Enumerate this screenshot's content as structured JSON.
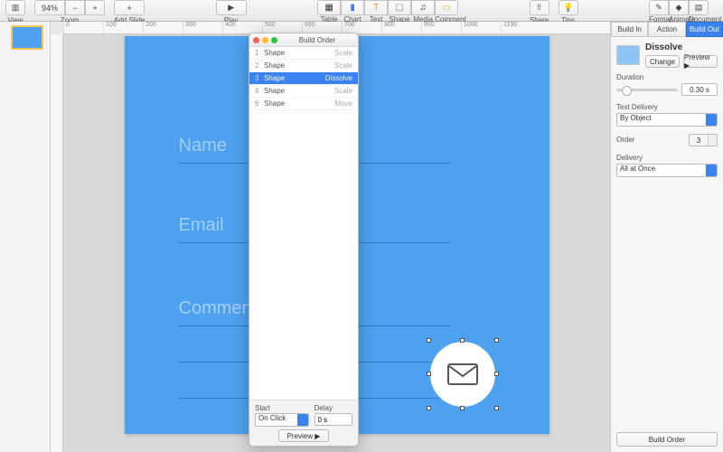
{
  "toolbar": {
    "view_label": "View",
    "zoom_value": "94%",
    "zoom_label": "Zoom",
    "add_slide_label": "Add Slide",
    "play_label": "Play",
    "mid": [
      "Table",
      "Chart",
      "Text",
      "Shape",
      "Media",
      "Comment"
    ],
    "share_label": "Share",
    "tips_label": "Tips",
    "right": [
      "Format",
      "Animate",
      "Document"
    ]
  },
  "slide": {
    "fields": [
      "Name",
      "Email",
      "Comments"
    ]
  },
  "ruler": [
    "0",
    "100",
    "200",
    "300",
    "400",
    "500",
    "600",
    "700",
    "800",
    "900",
    "1000",
    "1100"
  ],
  "build_order": {
    "title": "Build Order",
    "rows": [
      {
        "n": "1",
        "name": "Shape",
        "effect": "Scale"
      },
      {
        "n": "2",
        "name": "Shape",
        "effect": "Scale"
      },
      {
        "n": "3",
        "name": "Shape",
        "effect": "Dissolve",
        "selected": true
      },
      {
        "n": "4",
        "name": "Shape",
        "effect": "Scale"
      },
      {
        "n": "6",
        "name": "Shape",
        "effect": "Move"
      }
    ],
    "start_label": "Start",
    "start_value": "On Click",
    "delay_label": "Delay",
    "delay_value": "0 s",
    "preview_label": "Preview ▶"
  },
  "inspector": {
    "tabs": [
      "Build In",
      "Action",
      "Build Out"
    ],
    "effect_name": "Dissolve",
    "change_label": "Change",
    "preview_label": "Preview ▶",
    "duration_label": "Duration",
    "duration_value": "0.30 s",
    "text_delivery_label": "Text Delivery",
    "text_delivery_value": "By Object",
    "order_label": "Order",
    "order_value": "3",
    "delivery_label": "Delivery",
    "delivery_value": "All at Once",
    "build_order_btn": "Build Order"
  }
}
